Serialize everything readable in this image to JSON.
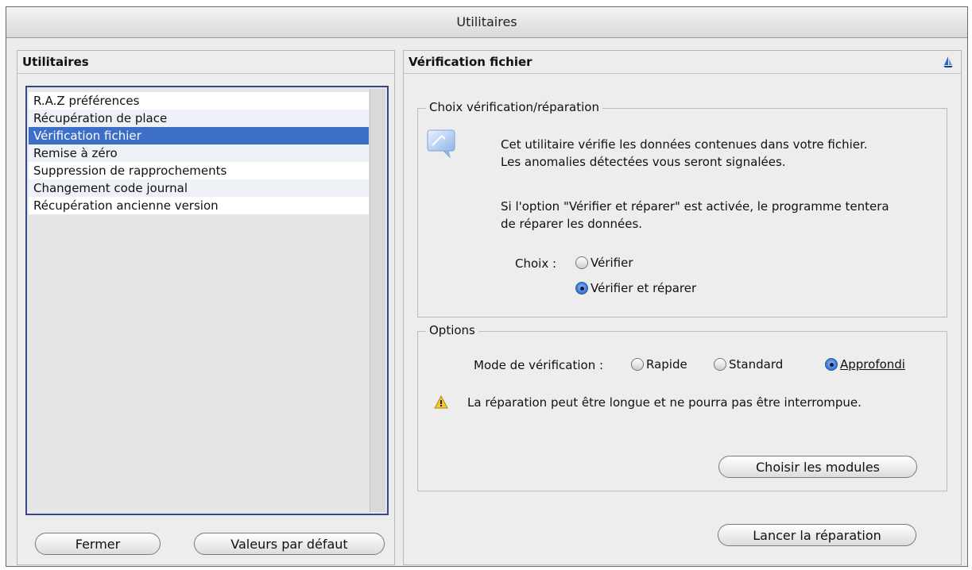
{
  "window": {
    "title": "Utilitaires"
  },
  "left_panel": {
    "header": "Utilitaires",
    "items": [
      "R.A.Z préférences",
      "Récupération de place",
      "Vérification fichier",
      "Remise à zéro",
      "Suppression de rapprochements",
      "Changement code journal",
      "Récupération ancienne version"
    ],
    "selected_index": 2,
    "close_label": "Fermer",
    "defaults_label": "Valeurs par défaut"
  },
  "right_panel": {
    "header": "Vérification fichier",
    "header_icon": "help-sailboat-icon",
    "check_group": {
      "legend": "Choix vérification/réparation",
      "icon": "info-bubble-icon",
      "text1_line1": "Cet utilitaire vérifie les données contenues dans votre fichier.",
      "text1_line2": "Les anomalies détectées vous seront signalées.",
      "text2_line1": "Si l'option \"Vérifier et réparer\" est activée, le programme tentera",
      "text2_line2": "de réparer les données.",
      "choice_label": "Choix :",
      "option_verify": "Vérifier",
      "option_verify_repair": "Vérifier et réparer",
      "selected": "Vérifier et réparer"
    },
    "options_group": {
      "legend": "Options",
      "mode_label": "Mode de vérification :",
      "mode_rapid": "Rapide",
      "mode_standard": "Standard",
      "mode_deep": "Approfondi",
      "selected_mode": "Approfondi",
      "warning_icon": "warning-triangle-icon",
      "warning": "La réparation peut être longue et ne pourra pas être interrompue.",
      "modules_button": "Choisir les modules"
    },
    "run_button": "Lancer la réparation"
  },
  "colors": {
    "selection": "#3d6fc9",
    "list_border": "#3b4784",
    "accent_blue": "#3e7bd6"
  }
}
